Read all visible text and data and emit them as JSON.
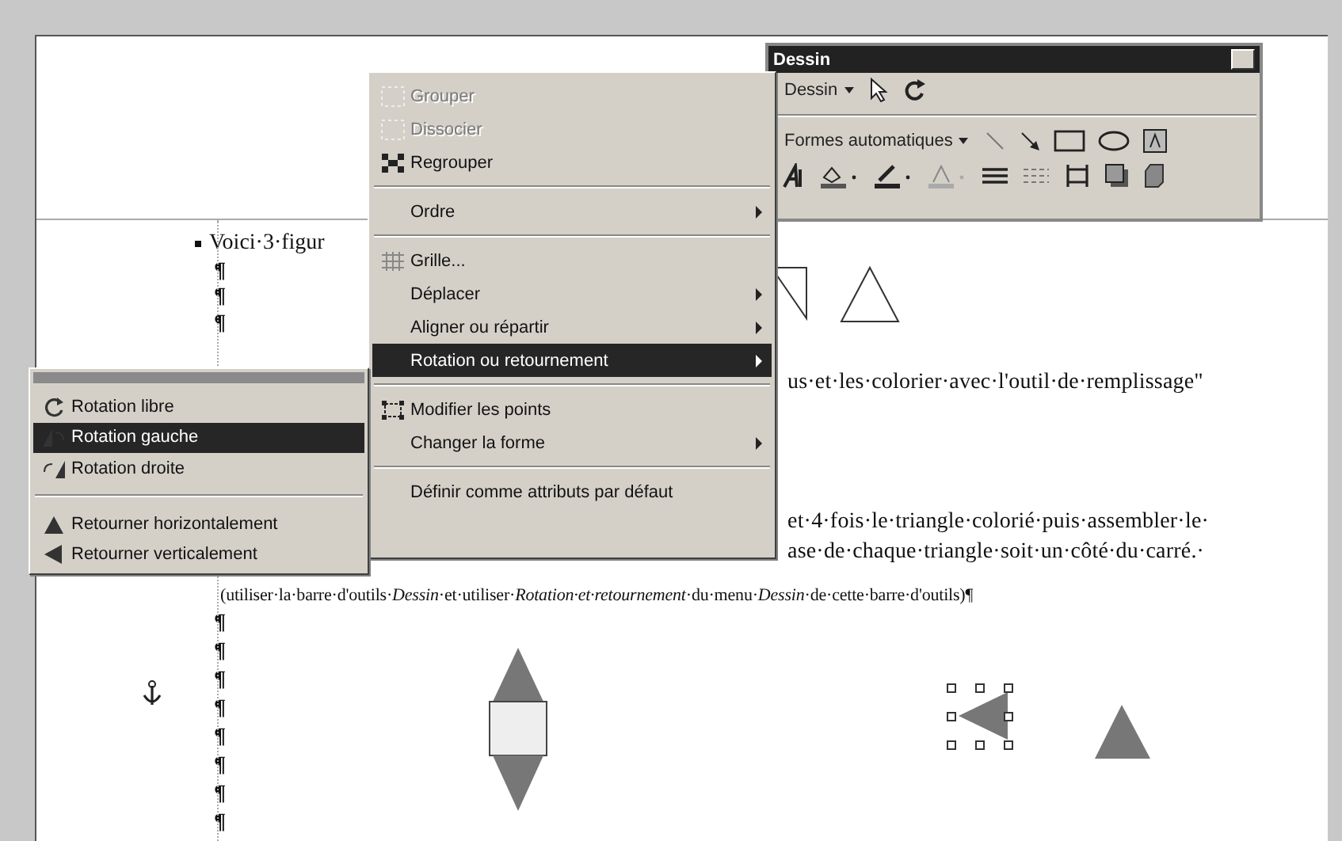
{
  "document": {
    "lines": [
      {
        "kind": "bullet",
        "text": "Voici·3·figur"
      },
      {
        "kind": "mark",
        "text": "¶"
      },
      {
        "kind": "mark",
        "text": "¶"
      },
      {
        "kind": "mark",
        "text": "¶"
      },
      {
        "kind": "clipped",
        "text": "us·et·les·colorier·avec·l'outil·de·remplissage\""
      },
      {
        "kind": "clipped",
        "text": "et·4·fois·le·triangle·colorié·puis·assembler·le·"
      },
      {
        "kind": "clipped",
        "text": "ase·de·chaque·triangle·soit·un·côté·du·carré.·"
      },
      {
        "kind": "note",
        "text": "(utiliser·la·barre·d'outils·*Dessin*·et·utiliser·*Rotation·et·retournement*·du·menu·*Dessin*·de·cette·barre·d'outils)¶"
      },
      {
        "kind": "mark",
        "text": "¶"
      },
      {
        "kind": "mark",
        "text": "¶"
      },
      {
        "kind": "mark",
        "text": "¶"
      },
      {
        "kind": "mark",
        "text": "¶"
      },
      {
        "kind": "mark",
        "text": "¶"
      },
      {
        "kind": "mark",
        "text": "¶"
      },
      {
        "kind": "mark",
        "text": "¶"
      },
      {
        "kind": "mark",
        "text": "¶"
      }
    ]
  },
  "context_menu": {
    "items": [
      {
        "kind": "item",
        "label": "Grouper",
        "disabled": true,
        "selected": false,
        "submenu": false
      },
      {
        "kind": "item",
        "label": "Dissocier",
        "disabled": true,
        "selected": false,
        "submenu": false
      },
      {
        "kind": "item",
        "label": "Regrouper",
        "disabled": false,
        "selected": false,
        "submenu": false
      },
      {
        "kind": "separator"
      },
      {
        "kind": "item",
        "label": "Ordre",
        "disabled": false,
        "selected": false,
        "submenu": true
      },
      {
        "kind": "separator"
      },
      {
        "kind": "item",
        "label": "Grille...",
        "disabled": false,
        "selected": false,
        "submenu": false
      },
      {
        "kind": "item",
        "label": "Déplacer",
        "disabled": false,
        "selected": false,
        "submenu": true
      },
      {
        "kind": "item",
        "label": "Aligner ou répartir",
        "disabled": false,
        "selected": false,
        "submenu": true
      },
      {
        "kind": "item",
        "label": "Rotation ou retournement",
        "disabled": false,
        "selected": true,
        "submenu": true
      },
      {
        "kind": "separator"
      },
      {
        "kind": "item",
        "label": "Modifier les points",
        "disabled": false,
        "selected": false,
        "submenu": false
      },
      {
        "kind": "item",
        "label": "Changer la forme",
        "disabled": false,
        "selected": false,
        "submenu": true
      },
      {
        "kind": "separator"
      },
      {
        "kind": "item",
        "label": "Définir comme attributs par défaut",
        "disabled": false,
        "selected": false,
        "submenu": false
      }
    ]
  },
  "submenu": {
    "items": [
      {
        "kind": "item",
        "label": "Rotation libre",
        "selected": false
      },
      {
        "kind": "item",
        "label": "Rotation gauche",
        "selected": true
      },
      {
        "kind": "item",
        "label": "Rotation droite",
        "selected": false
      },
      {
        "kind": "separator"
      },
      {
        "kind": "item",
        "label": "Retourner horizontalement",
        "selected": false
      },
      {
        "kind": "item",
        "label": "Retourner verticalement",
        "selected": false
      }
    ]
  },
  "toolbar": {
    "title": "Dessin",
    "menu_button": "Dessin",
    "autoshapes_button": "Formes automatiques"
  }
}
